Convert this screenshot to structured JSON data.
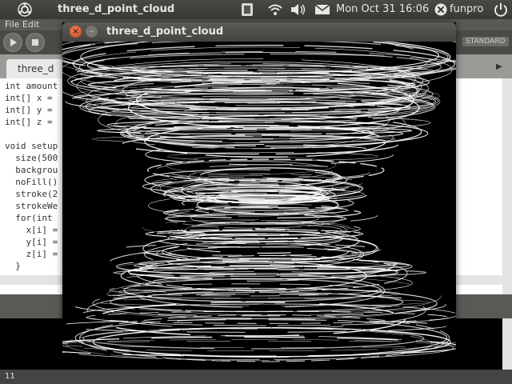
{
  "top_panel": {
    "app_title": "three_d_point_cloud",
    "clock": "Mon Oct 31 16:06",
    "username": "funpro",
    "icons": [
      "ubuntu-logo-icon",
      "keyboard-layout-icon",
      "wifi-icon",
      "volume-icon",
      "mail-icon",
      "close-circle-icon",
      "power-icon"
    ]
  },
  "ide": {
    "menu_text": "File Edit",
    "tab_label": "three_d",
    "mode_label": "STANDARD",
    "code_lines": [
      "int amount",
      "int[] x =",
      "int[] y =",
      "int[] z =",
      "",
      "void setup",
      "  size(500",
      "  backgrou",
      "  noFill()",
      "  stroke(2",
      "  strokeWe",
      "  for(int",
      "    x[i] =",
      "    y[i] =",
      "    z[i] =",
      "  }"
    ],
    "line_number": "11"
  },
  "sketch_window": {
    "title": "three_d_point_cloud",
    "canvas_background": "#000000",
    "stroke_color": "#ffffff"
  }
}
